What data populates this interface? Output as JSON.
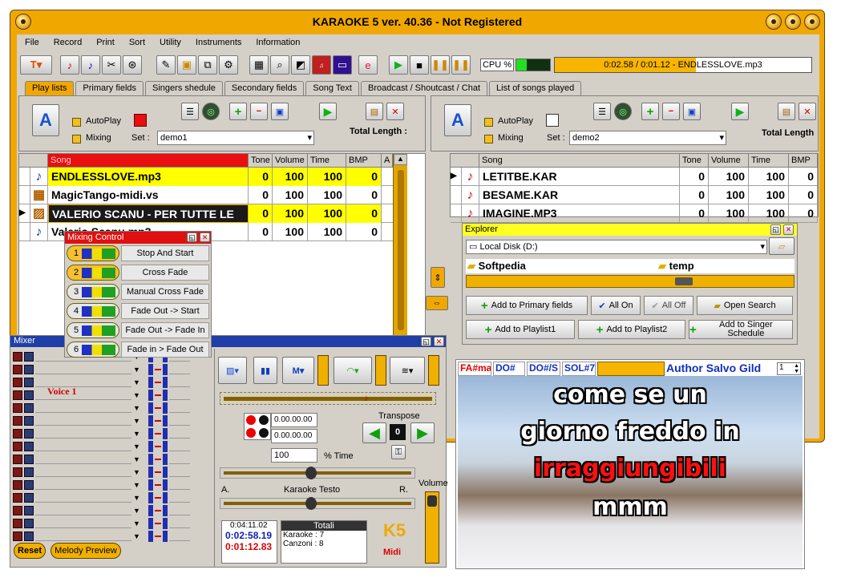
{
  "window": {
    "title": "KARAOKE 5   ver. 40.36  - Not Registered"
  },
  "menu": [
    "File",
    "Record",
    "Print",
    "Sort",
    "Utility",
    "Instruments",
    "Information"
  ],
  "toolbar": {
    "cpu_label": "CPU %",
    "progress_text": "0:02.58 / 0:01.12 - ENDLESSLOVE.mp3",
    "progress_fraction": 0.55,
    "play_color": "#12b01a"
  },
  "tabs": [
    "Play lists",
    "Primary fields",
    "Singers shedule",
    "Secondary fields",
    "Song Text",
    "Broadcast / Shoutcast / Chat",
    "List of songs played"
  ],
  "left_player": {
    "autoplay": "AutoPlay",
    "mixing": "Mixing",
    "set_label": "Set :",
    "set_value": "demo1",
    "total_length": "Total Length :"
  },
  "right_player": {
    "autoplay": "AutoPlay",
    "mixing": "Mixing",
    "set_label": "Set :",
    "set_value": "demo2",
    "total_length": "Total Length"
  },
  "left_playlist": {
    "columns": [
      "Song",
      "Tone",
      "Volume",
      "Time",
      "BMP",
      "A"
    ],
    "rows": [
      {
        "song": "ENDLESSLOVE.mp3",
        "tone": "0",
        "volume": "100",
        "time": "100",
        "bmp": "0",
        "highlight": true
      },
      {
        "song": "MagicTango-midi.vs",
        "tone": "0",
        "volume": "100",
        "time": "100",
        "bmp": "0",
        "highlight": false
      },
      {
        "song": "VALERIO SCANU - PER TUTTE LE",
        "tone": "0",
        "volume": "100",
        "time": "100",
        "bmp": "0",
        "highlight": true
      },
      {
        "song": "Valerio Scanu.mp3",
        "tone": "0",
        "volume": "100",
        "time": "100",
        "bmp": "0",
        "highlight": false
      }
    ]
  },
  "right_playlist": {
    "columns": [
      "Song",
      "Tone",
      "Volume",
      "Time",
      "BMP"
    ],
    "rows": [
      {
        "song": "LETITBE.KAR",
        "tone": "0",
        "volume": "100",
        "time": "100",
        "bmp": "0"
      },
      {
        "song": "BESAME.KAR",
        "tone": "0",
        "volume": "100",
        "time": "100",
        "bmp": "0"
      },
      {
        "song": "IMAGINE.MP3",
        "tone": "0",
        "volume": "100",
        "time": "100",
        "bmp": "0"
      }
    ]
  },
  "mixing_control": {
    "title": "Mixing Control",
    "items": [
      "Stop And Start",
      "Cross Fade",
      "Manual Cross Fade",
      "Fade Out -> Start",
      "Fade Out -> Fade In",
      "Fade in > Fade Out"
    ],
    "numbers": [
      "1",
      "2",
      "3",
      "4",
      "5",
      "6"
    ]
  },
  "explorer": {
    "title": "Explorer",
    "drive": "Local Disk (D:)",
    "folders": [
      "Softpedia",
      "temp"
    ],
    "buttons": [
      "Add to Primary fields",
      "All On",
      "All Off",
      "Open Search",
      "Add to Playlist1",
      "Add to Playlist2",
      "Add to Singer Schedule"
    ]
  },
  "mixer": {
    "title": "Mixer",
    "voice_label": "Voice 1",
    "reset": "Reset",
    "melody_preview": "Melody Preview"
  },
  "transport": {
    "time1": "0.00.00.00",
    "time2": "0.00.00.00",
    "transpose_label": "Transpose",
    "transpose_value": "0",
    "time_value": "100",
    "time_label": "% Time",
    "balance_left": "A.",
    "balance_center": "Karaoke Testo",
    "balance_right": "R.",
    "volume_label": "Volume",
    "total_time": "0:04:11.02",
    "elapsed": "0:02:58.19",
    "remaining": "0:01:12.83",
    "totali": "Totali",
    "karaoke": "Karaoke : 7",
    "canzoni": "Canzoni  : 8",
    "logo_sub": "Midi"
  },
  "lyrics": {
    "chords": [
      "FA#ma",
      "DO#",
      "DO#/S",
      "SOL#7"
    ],
    "author": "Author Salvo Gild",
    "page": "1",
    "lines": [
      "come se un",
      "giorno freddo in",
      "irraggiungibili",
      "mmm"
    ]
  }
}
